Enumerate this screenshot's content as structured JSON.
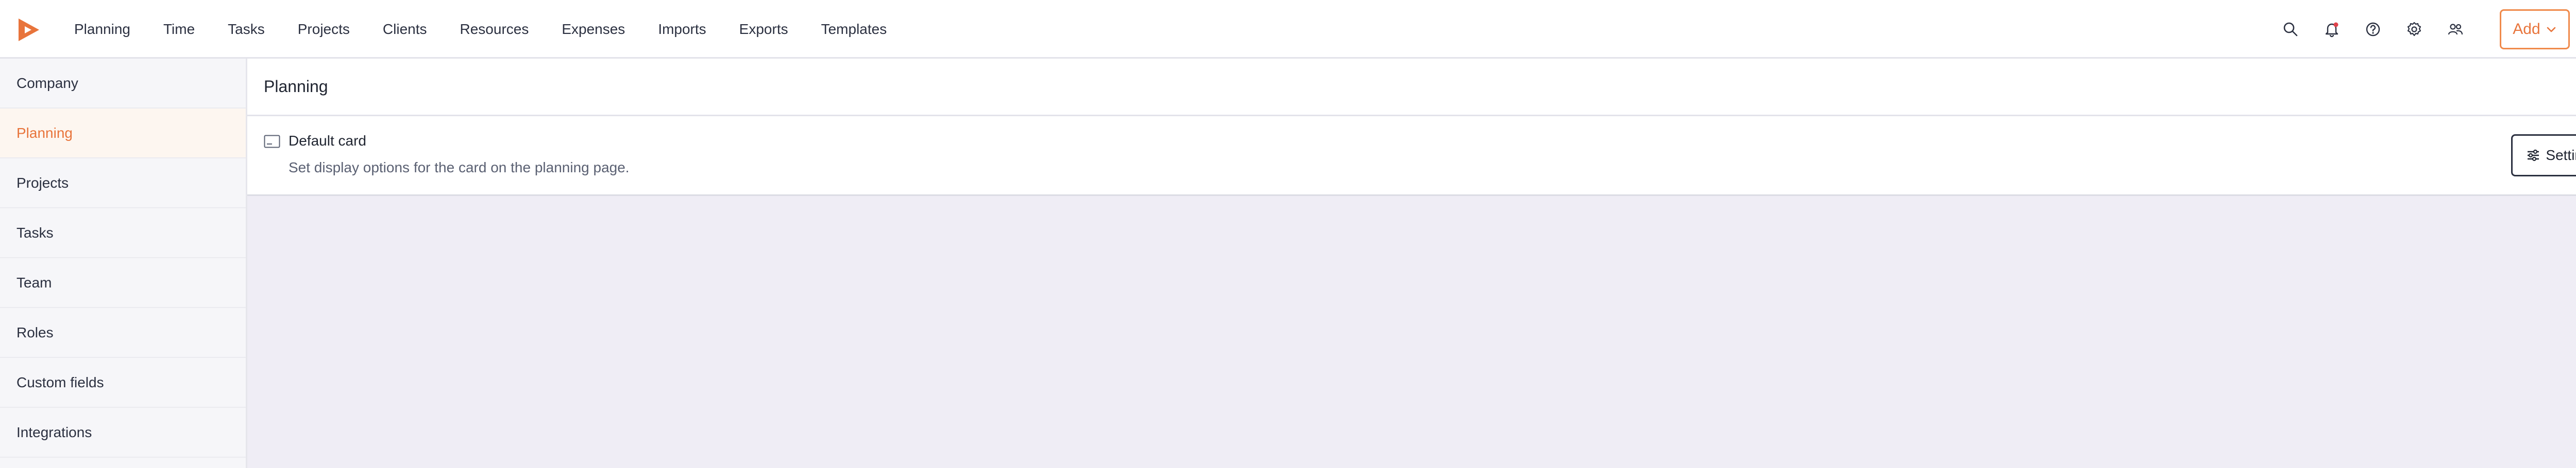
{
  "nav": {
    "items": [
      "Planning",
      "Time",
      "Tasks",
      "Projects",
      "Clients",
      "Resources",
      "Expenses",
      "Imports",
      "Exports",
      "Templates"
    ]
  },
  "toolbar": {
    "icons": [
      "search-icon",
      "bell-icon",
      "help-icon",
      "gear-icon",
      "team-icon"
    ],
    "add_label": "Add"
  },
  "sidebar": {
    "items": [
      {
        "label": "Company"
      },
      {
        "label": "Planning"
      },
      {
        "label": "Projects"
      },
      {
        "label": "Tasks"
      },
      {
        "label": "Team"
      },
      {
        "label": "Roles"
      },
      {
        "label": "Custom fields"
      },
      {
        "label": "Integrations"
      }
    ],
    "active_index": 1
  },
  "main": {
    "title": "Planning",
    "card": {
      "title": "Default card",
      "description": "Set display options for the card on the planning page.",
      "button_label": "Settings"
    }
  },
  "colors": {
    "accent": "#e8743b",
    "text": "#1f2430",
    "muted": "#5a6072",
    "sidebar_bg": "#f6f6f9",
    "content_bg": "#efedf5"
  }
}
